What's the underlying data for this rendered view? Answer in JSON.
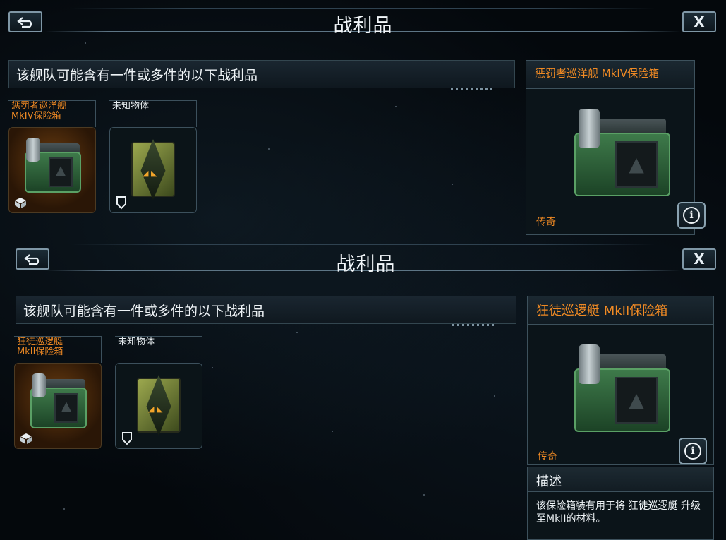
{
  "colors": {
    "accent_orange": "#f08a24",
    "frame_blue": "#7f97a6",
    "legendary_bg": "#6b3d10"
  },
  "panels": [
    {
      "header": {
        "title": "战利品",
        "back_icon": "back-arrow-icon",
        "close_label": "X"
      },
      "notice": "该舰队可能含有一件或多件的以下战利品",
      "items": [
        {
          "label": "惩罚者巡洋舰 MkIV保险箱",
          "rarity_style": "legendary",
          "icon": "vault-chest",
          "badge_icon": "loot-box-icon"
        },
        {
          "label": "未知物体",
          "rarity_style": "normal",
          "icon": "unknown-object",
          "badge_icon": "shield-icon"
        }
      ],
      "detail": {
        "title": "惩罚者巡洋舰 MkIV保险箱",
        "rarity": "传奇",
        "info_icon": "info-icon"
      }
    },
    {
      "header": {
        "title": "战利品",
        "back_icon": "back-arrow-icon",
        "close_label": "X"
      },
      "notice": "该舰队可能含有一件或多件的以下战利品",
      "items": [
        {
          "label": "狂徒巡逻艇 MkII保险箱",
          "rarity_style": "legendary",
          "icon": "vault-chest",
          "badge_icon": "loot-box-icon"
        },
        {
          "label": "未知物体",
          "rarity_style": "normal",
          "icon": "unknown-object",
          "badge_icon": "shield-icon"
        }
      ],
      "detail": {
        "title": "狂徒巡逻艇 MkII保险箱",
        "rarity": "传奇",
        "info_icon": "info-icon",
        "description_title": "描述",
        "description_text": "该保险箱装有用于将 狂徒巡逻艇 升级至MkII的材料。"
      }
    }
  ]
}
